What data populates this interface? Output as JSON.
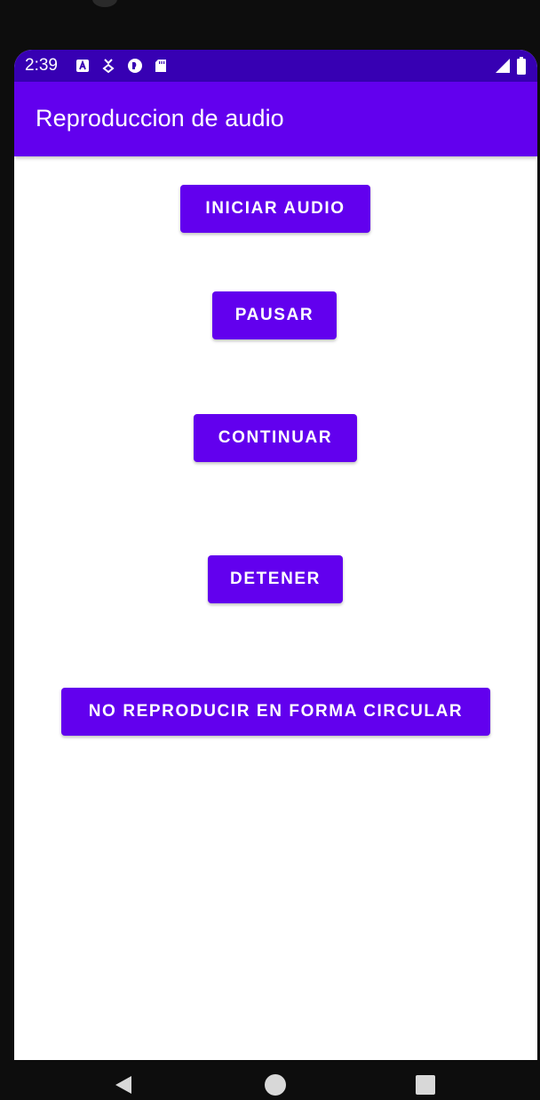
{
  "status_bar": {
    "time": "2:39",
    "left_icons": [
      "text-a-icon",
      "download-icon",
      "circle-app-icon",
      "sd-card-icon"
    ],
    "right_icons": [
      "signal-icon",
      "battery-icon"
    ]
  },
  "app_bar": {
    "title": "Reproduccion de audio"
  },
  "buttons": {
    "iniciar": "INICIAR AUDIO",
    "pausar": "PAUSAR",
    "continuar": "CONTINUAR",
    "detener": "DETENER",
    "circular": "NO REPRODUCIR EN FORMA CIRCULAR"
  },
  "navigation": {
    "icons": [
      "back-icon",
      "home-icon",
      "recents-icon"
    ]
  },
  "colors": {
    "primary": "#6200ee",
    "primary_dark": "#3700b3",
    "on_primary": "#ffffff",
    "background": "#ffffff"
  }
}
